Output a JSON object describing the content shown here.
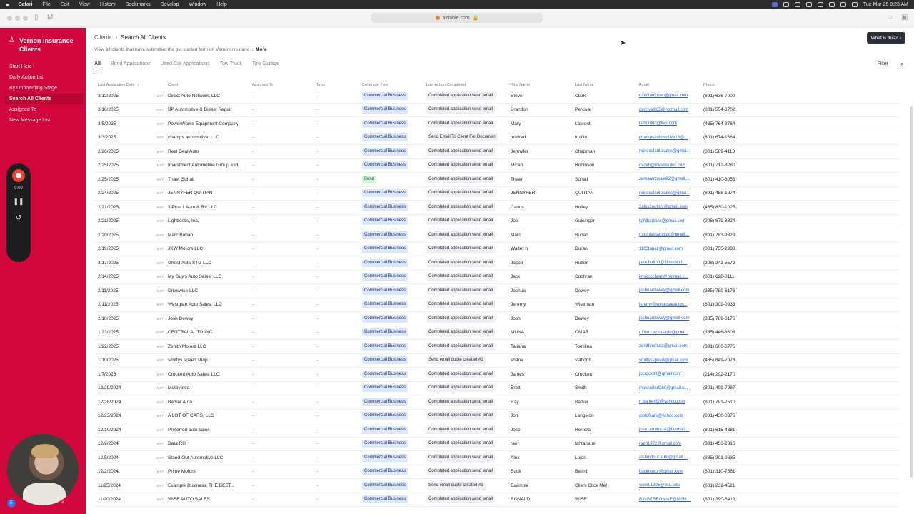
{
  "menubar": {
    "app": "Safari",
    "items": [
      "File",
      "Edit",
      "View",
      "History",
      "Bookmarks",
      "Develop",
      "Window",
      "Help"
    ],
    "clock": "Tue Mar 25  9:23 AM"
  },
  "browser": {
    "url": "airtable.com"
  },
  "sidebar": {
    "title": "Vernon Insurance Clients",
    "items": [
      {
        "label": "Start Here"
      },
      {
        "label": "Daily Action List"
      },
      {
        "label": "By Onboarding Stage"
      },
      {
        "label": "Search All Clients"
      },
      {
        "label": "Assigned To"
      },
      {
        "label": "New Message List"
      }
    ]
  },
  "recorder": {
    "time": "0:00"
  },
  "webcam": {
    "badge": "E"
  },
  "main": {
    "breadcrumb_parent": "Clients",
    "breadcrumb_current": "Search All Clients",
    "description": "View all clients that have submitted the get started form on Vernon insuranc ...",
    "more": "More",
    "what_is_this": "What is this?",
    "filter": "Filter",
    "tabs": [
      "All",
      "Bond Applications",
      "Used Car Applications",
      "Tow Truck",
      "Tow Garage"
    ]
  },
  "table": {
    "columns": [
      "Last Application Date",
      "Client",
      "Assigned To",
      "Type",
      "Coverage Type",
      "Last Action Completed",
      "First Name",
      "Last Name",
      "Email",
      "Phone"
    ],
    "tz": "MST",
    "rows": [
      {
        "date": "3/13/2025",
        "client": "Direct Auto Network, LLC",
        "assigned": "–",
        "type": "–",
        "coverage": "Commercial Business",
        "action": "Completed application send email",
        "first": "Steve",
        "last": "Clark",
        "email": "directautonet@gmail.com",
        "phone": "(801) 636-7000"
      },
      {
        "date": "3/10/2025",
        "client": "BP Automotive & Diesel Repair",
        "assigned": "–",
        "type": "–",
        "coverage": "Commercial Business",
        "action": "Completed application send email",
        "first": "Brandon",
        "last": "Percival",
        "email": "percival065@hotmail.com",
        "phone": "(801) 554-3702"
      },
      {
        "date": "3/5/2025",
        "client": "PowerWorks Equipment Company",
        "assigned": "–",
        "type": "–",
        "coverage": "Commercial Business",
        "action": "Completed application send email",
        "first": "Mary",
        "last": "LaMont",
        "email": "lamont03@live.com",
        "phone": "(435) 764-3784"
      },
      {
        "date": "3/3/2025",
        "client": "champs automotive, LLC",
        "assigned": "–",
        "type": "–",
        "coverage": "Commercial Business",
        "action": "Send Email To Client For Documen",
        "first": "mildred",
        "last": "trujillo",
        "email": "champsautomotive13@...",
        "phone": "(801) 674-1364"
      },
      {
        "date": "2/26/2025",
        "client": "Reel Deal Auto",
        "assigned": "–",
        "type": "–",
        "coverage": "Commercial Business",
        "action": "Completed application send email",
        "first": "Jennyfer",
        "last": "Chapman",
        "email": "reeldealautosales@gmai...",
        "phone": "(801) 589-4113"
      },
      {
        "date": "2/25/2025",
        "client": "Investment Automotive Group and...",
        "assigned": "–",
        "type": "–",
        "coverage": "Commercial Business",
        "action": "Completed application send email",
        "first": "Micah",
        "last": "Robinson",
        "email": "micah@investautos.com",
        "phone": "(801) 712-8280"
      },
      {
        "date": "2/25/2025",
        "client": "Thaer Suhail",
        "assigned": "–",
        "type": "–",
        "coverage": "Bond",
        "action": "Completed application send email",
        "first": "Thaer",
        "last": "Suhail",
        "email": "samaautosale92@gmail....",
        "phone": "(801) 410-3053"
      },
      {
        "date": "2/24/2025",
        "client": "JENNYFER QUITIAN",
        "assigned": "–",
        "type": "–",
        "coverage": "Commercial Business",
        "action": "Completed application send email",
        "first": "JENNYFER",
        "last": "QUITIAN",
        "email": "reeldealautosales@gmai...",
        "phone": "(801) 458-1974"
      },
      {
        "date": "2/21/2025",
        "client": "3 Plus 1 Auto & RV LLC",
        "assigned": "–",
        "type": "–",
        "coverage": "Commercial Business",
        "action": "Completed application send email",
        "first": "Carlos",
        "last": "Holley",
        "email": "3plus1autorv@gmail.com",
        "phone": "(435) 830-1025"
      },
      {
        "date": "2/21/2025",
        "client": "Lightfoot's, Inc.",
        "assigned": "–",
        "type": "–",
        "coverage": "Commercial Business",
        "action": "Completed application send email",
        "first": "Joe",
        "last": "Guisinger",
        "email": "lightfootsinc@gmail.com",
        "phone": "(206) 679-8824"
      },
      {
        "date": "2/20/2025",
        "client": "Marc Buban",
        "assigned": "–",
        "type": "–",
        "coverage": "Commercial Business",
        "action": "Completed application send email",
        "first": "Marc",
        "last": "Buban",
        "email": "mountainautoslc@gmail....",
        "phone": "(801) 783-9329"
      },
      {
        "date": "2/19/2025",
        "client": "JKW Motors LLC",
        "assigned": "–",
        "type": "–",
        "coverage": "Commercial Business",
        "action": "Completed application send email",
        "first": "Walter h",
        "last": "Duran",
        "email": "1103topaz@gmail.com",
        "phone": "(801) 755-2938"
      },
      {
        "date": "2/17/2025",
        "client": "Ghost Auto STG LLC",
        "assigned": "–",
        "type": "–",
        "coverage": "Commercial Business",
        "action": "Completed application send email",
        "first": "Jacob",
        "last": "Hutton",
        "email": "jake.hutton@fitnesscult...",
        "phone": "(208) 241-5572"
      },
      {
        "date": "2/14/2025",
        "client": "My Guy's Auto Sales, LLC",
        "assigned": "–",
        "type": "–",
        "coverage": "Commercial Business",
        "action": "Completed application send email",
        "first": "Jack",
        "last": "Cochran",
        "email": "jmskcochran@hotmail.c...",
        "phone": "(801) 628-8111"
      },
      {
        "date": "2/11/2025",
        "client": "Drivewise LLC",
        "assigned": "–",
        "type": "–",
        "coverage": "Commercial Business",
        "action": "Completed application send email",
        "first": "Joshua",
        "last": "Dewey",
        "email": "joshuardewey@gmail.com",
        "phone": "(385) 789-6176"
      },
      {
        "date": "2/11/2025",
        "client": "Westgate Auto Sales, LLC",
        "assigned": "–",
        "type": "–",
        "coverage": "Commercial Business",
        "action": "Completed application send email",
        "first": "Jeremy",
        "last": "Wiseman",
        "email": "jeremy@westgateautos...",
        "phone": "(801) 309-0933"
      },
      {
        "date": "2/10/2025",
        "client": "Josh Dewey",
        "assigned": "–",
        "type": "–",
        "coverage": "Commercial Business",
        "action": "Completed application send email",
        "first": "Josh",
        "last": "Dewey",
        "email": "joshuardewey@gmail.com",
        "phone": "(385) 789-6176"
      },
      {
        "date": "1/23/2025",
        "client": "CENTRAL AUTO INC",
        "assigned": "–",
        "type": "–",
        "coverage": "Commercial Business",
        "action": "Completed application send email",
        "first": "MUNA",
        "last": "OMAR",
        "email": "office.centralauto@gma...",
        "phone": "(385) 446-8803"
      },
      {
        "date": "1/22/2025",
        "client": "Zenith Motorz LLC",
        "assigned": "–",
        "type": "–",
        "coverage": "Commercial Business",
        "action": "Completed application send email",
        "first": "Tatiana",
        "last": "Tomilina",
        "email": "zenithmotorz@gmail.com",
        "phone": "(801) 600-6776"
      },
      {
        "date": "1/10/2025",
        "client": "smittys speed shop",
        "assigned": "–",
        "type": "–",
        "coverage": "Commercial Business",
        "action": "Send email quote created #1",
        "first": "shane",
        "last": "stafford",
        "email": "smittysspeed@gmail.com",
        "phone": "(435) 849-7078"
      },
      {
        "date": "1/7/2025",
        "client": "Crockett Auto Sales, LLC",
        "assigned": "–",
        "type": "–",
        "coverage": "Commercial Business",
        "action": "Completed application send email",
        "first": "James",
        "last": "Crockett",
        "email": "jpcrockett@gmail.com",
        "phone": "(214) 202-2170"
      },
      {
        "date": "12/29/2024",
        "client": "Motovated",
        "assigned": "–",
        "type": "–",
        "coverage": "Commercial Business",
        "action": "Completed application send email",
        "first": "Brett",
        "last": "Smith",
        "email": "motovated360@gmail.c...",
        "phone": "(801) 499-7987"
      },
      {
        "date": "12/28/2024",
        "client": "Barker Auto",
        "assigned": "–",
        "type": "–",
        "coverage": "Commercial Business",
        "action": "Completed application send email",
        "first": "Ray",
        "last": "Barker",
        "email": "r_barker82@yahoo.com",
        "phone": "(801) 791-7510"
      },
      {
        "date": "12/23/2024",
        "client": "A LOT OF CARS, LLC",
        "assigned": "–",
        "type": "–",
        "coverage": "Commercial Business",
        "action": "Completed application send email",
        "first": "Jon",
        "last": "Langston",
        "email": "alotofcars@yahoo.com",
        "phone": "(801) 430-0376"
      },
      {
        "date": "12/10/2024",
        "client": "Preferred auto sales",
        "assigned": "–",
        "type": "–",
        "coverage": "Commercial Business",
        "action": "Completed application send email",
        "first": "Jose",
        "last": "Herrera",
        "email": "jose_arroba14@hotmail....",
        "phone": "(801) 615-4881"
      },
      {
        "date": "12/9/2024",
        "client": "Data RH",
        "assigned": "–",
        "type": "–",
        "coverage": "Commercial Business",
        "action": "Completed application send email",
        "first": "raef",
        "last": "tahtamuni",
        "email": "raeft1972@gmail.com",
        "phone": "(801) 450-2816"
      },
      {
        "date": "12/5/2024",
        "client": "Stand-Out Automotive LLC",
        "assigned": "–",
        "type": "–",
        "coverage": "Commercial Business",
        "action": "Completed application send email",
        "first": "Alex",
        "last": "Lujan",
        "email": "alstandout.auto@gmail....",
        "phone": "(385) 301-9635"
      },
      {
        "date": "12/2/2024",
        "client": "Prime Motors",
        "assigned": "–",
        "type": "–",
        "coverage": "Commercial Business",
        "action": "Completed application send email",
        "first": "Buck",
        "last": "Bellini",
        "email": "buckmotor@gmail.com",
        "phone": "(801) 310-7561"
      },
      {
        "date": "11/25/2024",
        "client": "Example Business, THE BEST...",
        "assigned": "–",
        "type": "–",
        "coverage": "Commercial Business",
        "action": "Send email quote created #1",
        "first": "Example",
        "last": "Client Click Me!",
        "email": "wood.1305@osu.edu",
        "phone": "(801) 232-4521"
      },
      {
        "date": "11/20/2024",
        "client": "WISE AUTO SALES",
        "assigned": "–",
        "type": "–",
        "coverage": "Commercial Business",
        "action": "Completed application send email",
        "first": "RONALD",
        "last": "WISE",
        "email": "RINGERRONNIE@MSN....",
        "phone": "(801) 390-6419"
      }
    ]
  }
}
